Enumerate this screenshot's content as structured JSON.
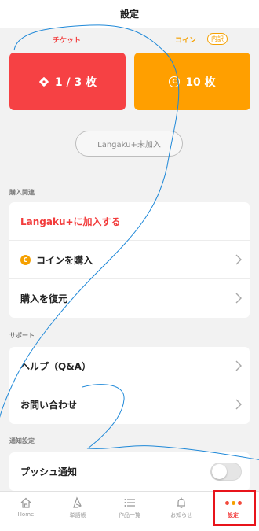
{
  "header": {
    "title": "設定"
  },
  "wallet": {
    "ticket_label": "チケット",
    "coin_label": "コイン",
    "coin_badge": "内訳",
    "ticket_value": "1 / 3 枚",
    "coin_value": "10 枚",
    "coin_symbol": "C"
  },
  "membership": {
    "status": "Langaku+未加入"
  },
  "sections": {
    "purchase": {
      "title": "購入関連",
      "items": [
        {
          "label": "Langaku+に加入する"
        },
        {
          "label": "コインを購入"
        },
        {
          "label": "購入を復元"
        }
      ]
    },
    "support": {
      "title": "サポート",
      "items": [
        {
          "label": "ヘルプ（Q&A）"
        },
        {
          "label": "お問い合わせ"
        }
      ]
    },
    "notification": {
      "title": "通知設定",
      "items": [
        {
          "label": "プッシュ通知",
          "enabled": false
        }
      ]
    }
  },
  "tabs": [
    {
      "label": "Home",
      "icon": "home-icon"
    },
    {
      "label": "単語帳",
      "icon": "wordbook-icon"
    },
    {
      "label": "作品一覧",
      "icon": "list-icon"
    },
    {
      "label": "お知らせ",
      "icon": "bell-icon"
    },
    {
      "label": "設定",
      "icon": "more-dots-icon",
      "active": true
    }
  ],
  "colors": {
    "ticket": "#f64144",
    "coin": "#ff9f00",
    "accent_red": "#f23c3c",
    "highlight": "#e8141b",
    "annotation": "#1e88d8",
    "dots": [
      "#f24a3c",
      "#f5a000",
      "#f24a3c"
    ]
  }
}
